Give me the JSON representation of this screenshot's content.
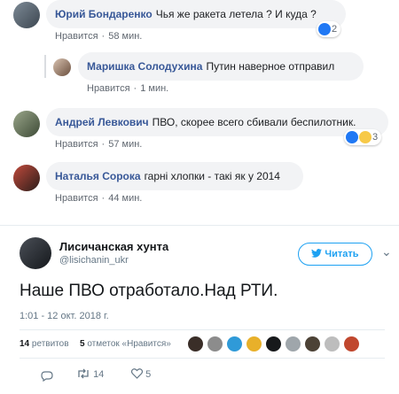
{
  "comments": [
    {
      "author": "Юрий Бондаренко",
      "text": "Чья же ракета летела ? И куда ?",
      "like": "Нравится",
      "sep": "·",
      "time": "58 мин.",
      "reactions": "2"
    },
    {
      "author": "Маришка Солодухина",
      "text": "Путин наверное отправил",
      "like": "Нравится",
      "sep": "·",
      "time": "1 мин."
    },
    {
      "author": "Андрей Левкович",
      "text": "ПВО, скорее всего сбивали беспилотник.",
      "like": "Нравится",
      "sep": "·",
      "time": "57 мин.",
      "reactions": "3"
    },
    {
      "author": "Наталья Сорока",
      "text": "гарні хлопки - такі як у 2014",
      "like": "Нравится",
      "sep": "·",
      "time": "44 мин."
    }
  ],
  "tweet": {
    "name": "Лисичанская хунта",
    "handle": "@lisichanin_ukr",
    "follow_label": "Читать",
    "more_glyph": "⌄",
    "text": "Наше ПВО отработало.Над РТИ.",
    "date": "1:01 - 12 окт. 2018 г.",
    "retweets_count": "14",
    "retweets_label": "ретвитов",
    "likes_count": "5",
    "likes_label": "отметок «Нравится»",
    "action_retweets": "14",
    "action_likes": "5"
  },
  "colors": {
    "fb_link": "#385898",
    "bubble": "#f2f3f5",
    "twitter_blue": "#1da1f2",
    "like_blue": "#2078f4",
    "wow_yellow": "#f7c948"
  }
}
